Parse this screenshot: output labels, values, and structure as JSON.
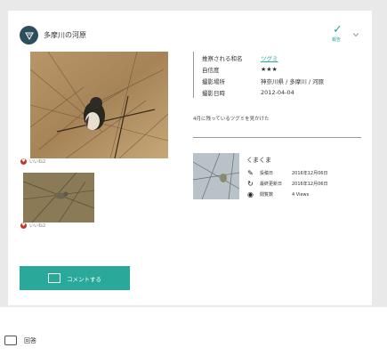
{
  "header": {
    "title": "多摩川の河原",
    "verify_label": "報告",
    "verify_icon": "check-icon",
    "menu_icon": "chevron-down-icon"
  },
  "photos": {
    "main_likes": "いいね2",
    "thumb_likes": "いいね2"
  },
  "info": {
    "rows": [
      {
        "label": "推察される和名",
        "value": "ツグミ"
      },
      {
        "label": "自信度",
        "value": "★★★"
      },
      {
        "label": "撮影場所",
        "value": "神奈川県 / 多摩川 / 河原"
      },
      {
        "label": "撮影日時",
        "value": "2012-04-04"
      }
    ]
  },
  "comment": "4月に残っているツグミを見かけた",
  "user": {
    "name": "くまくま",
    "posted_label": "投稿日",
    "posted_value": "2016年12月06日",
    "updated_label": "最終更新日",
    "updated_value": "2016年12月06日",
    "views_label": "閲覧数",
    "views_value": "4 Views"
  },
  "comment_button": "コメントする",
  "answer_label": "回答",
  "colors": {
    "accent": "#2aa899",
    "header_logo": "#2d4f5d",
    "like": "#c0392b"
  }
}
